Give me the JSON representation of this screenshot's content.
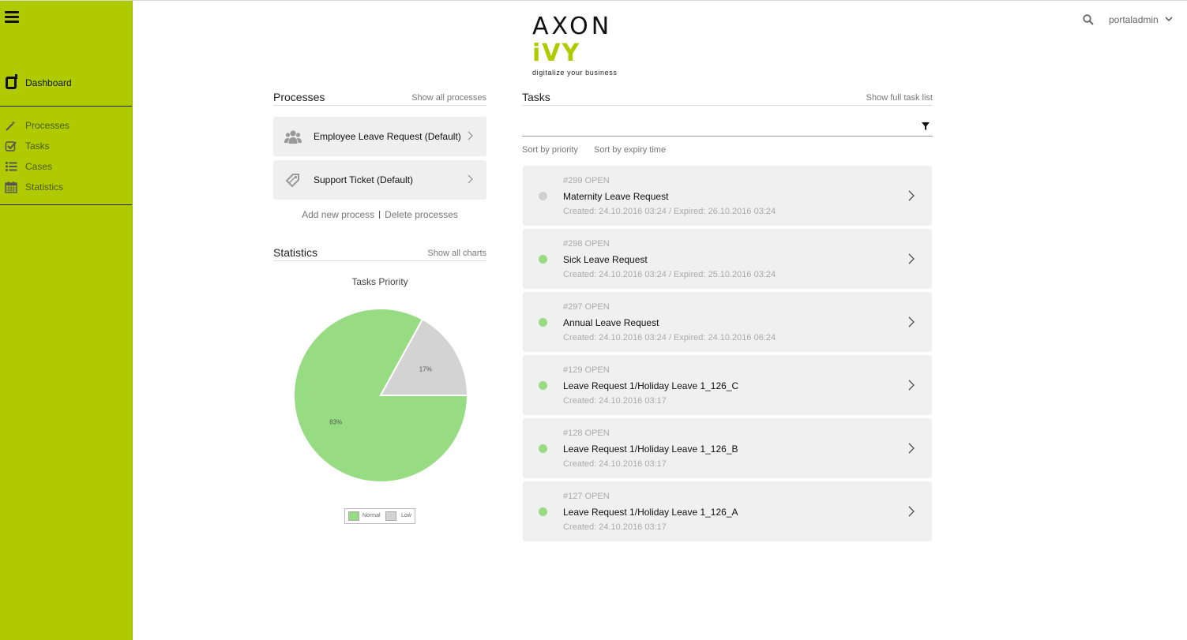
{
  "sidebar": {
    "dashboard_label": "Dashboard",
    "items": [
      {
        "label": "Processes",
        "icon": "wand-icon"
      },
      {
        "label": "Tasks",
        "icon": "check-square-icon"
      },
      {
        "label": "Cases",
        "icon": "list-icon"
      },
      {
        "label": "Statistics",
        "icon": "calendar-icon"
      }
    ],
    "color": "#afcb00"
  },
  "header": {
    "logo_text": "AXON",
    "logo_accent": "iVY",
    "logo_tagline": "digitalize your business",
    "username": "portaladmin"
  },
  "processes": {
    "title": "Processes",
    "link": "Show all processes",
    "items": [
      {
        "name": "Employee Leave Request (Default)",
        "icon": "users-icon"
      },
      {
        "name": "Support Ticket (Default)",
        "icon": "tag-icon"
      }
    ],
    "add_label": "Add new process",
    "delete_label": "Delete processes"
  },
  "statistics": {
    "title": "Statistics",
    "link": "Show all charts"
  },
  "chart_data": {
    "type": "pie",
    "title": "Tasks Priority",
    "categories": [
      "Normal",
      "Low"
    ],
    "values": [
      83,
      17
    ],
    "labels": [
      "83%",
      "17%"
    ],
    "colors": [
      "#97dc82",
      "#d3d3d3"
    ],
    "legend": "bottom"
  },
  "tasks": {
    "title": "Tasks",
    "link": "Show full task list",
    "sort_priority": "Sort by priority",
    "sort_expiry": "Sort by expiry time",
    "items": [
      {
        "id": "#299 OPEN",
        "name": "Maternity Leave Request",
        "date": "Created: 24.10.2016 03:24 / Expired: 26.10.2016 03:24",
        "status_color": "#d0d0d0"
      },
      {
        "id": "#298 OPEN",
        "name": "Sick Leave Request",
        "date": "Created: 24.10.2016 03:24 / Expired: 25.10.2016 03:24",
        "status_color": "#97dc82"
      },
      {
        "id": "#297 OPEN",
        "name": "Annual Leave Request",
        "date": "Created: 24.10.2016 03:24 / Expired: 24.10.2016 06:24",
        "status_color": "#97dc82"
      },
      {
        "id": "#129 OPEN",
        "name": "Leave Request 1/Holiday Leave 1_126_C",
        "date": "Created: 24.10.2016 03:17",
        "status_color": "#97dc82"
      },
      {
        "id": "#128 OPEN",
        "name": "Leave Request 1/Holiday Leave 1_126_B",
        "date": "Created: 24.10.2016 03:17",
        "status_color": "#97dc82"
      },
      {
        "id": "#127 OPEN",
        "name": "Leave Request 1/Holiday Leave 1_126_A",
        "date": "Created: 24.10.2016 03:17",
        "status_color": "#97dc82"
      }
    ]
  }
}
